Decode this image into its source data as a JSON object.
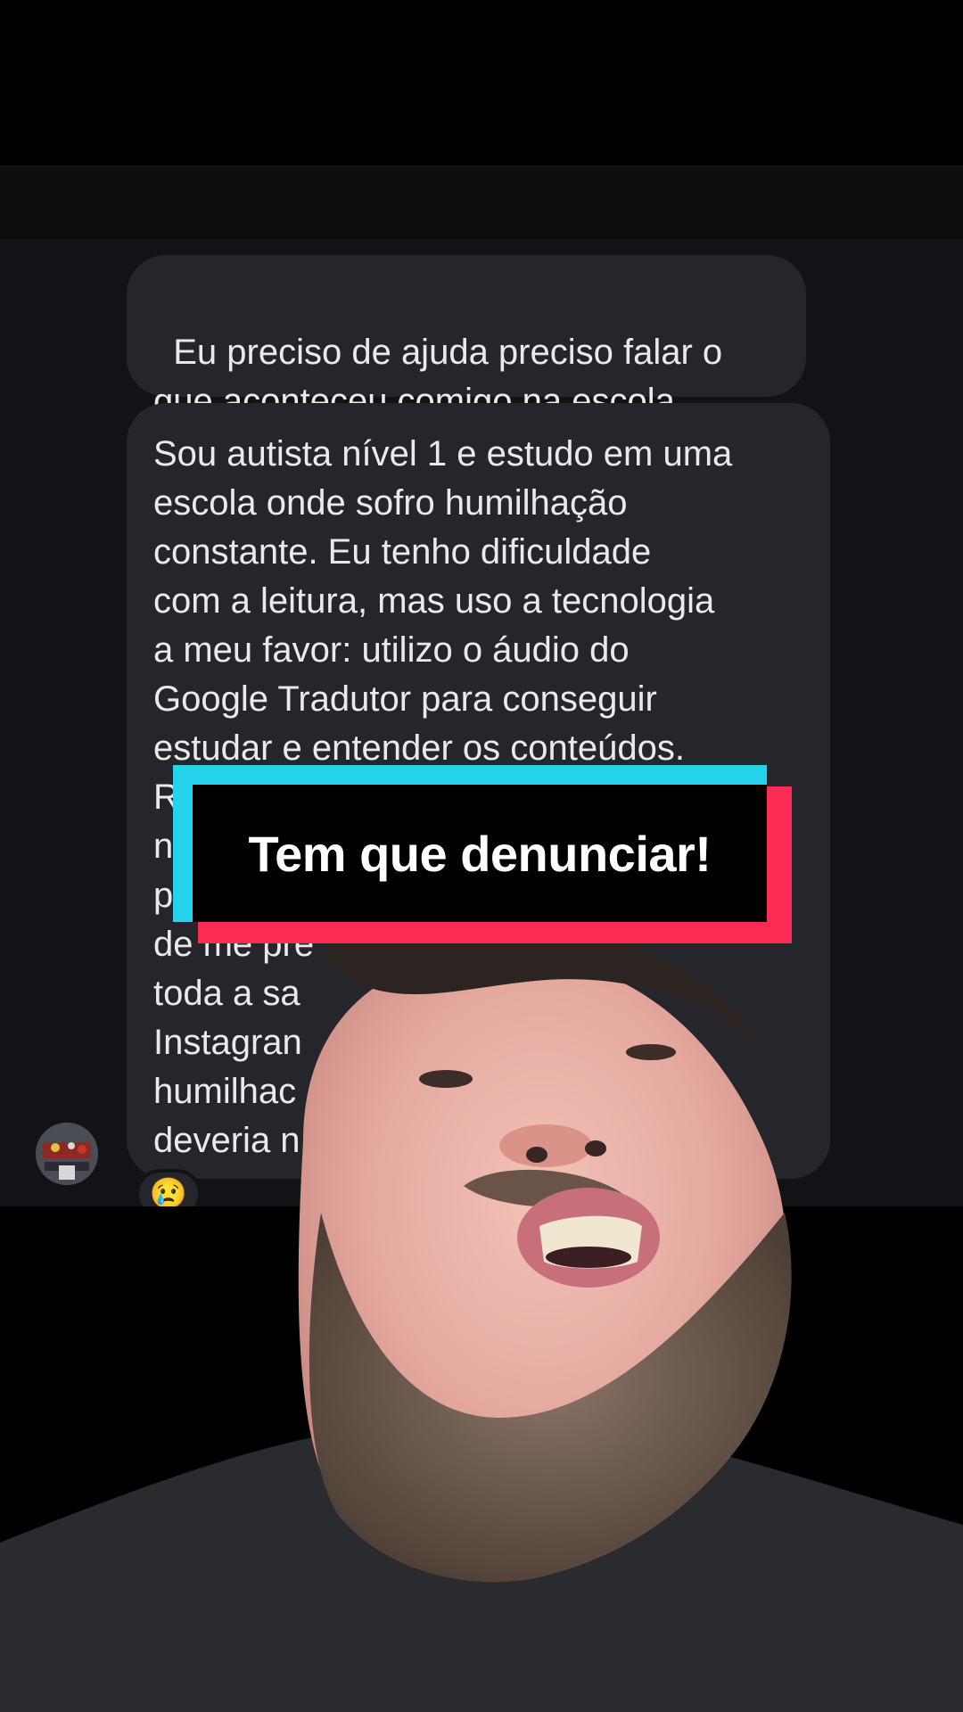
{
  "chat": {
    "message_1": "Eu preciso de ajuda preciso falar o\nque aconteceu comigo na escola",
    "message_2_lines": [
      "Sou autista nível 1 e estudo em uma",
      "escola onde sofro humilhação",
      "constante. Eu tenho dificuldade",
      "com a leitura, mas uso a tecnologia",
      "a meu favor: utilizo o áudio do",
      "Google Tradutor para conseguir",
      "estudar e entender os conteúdos.",
      "R",
      "n",
      "p",
      "de me pre",
      "toda a sa",
      "Instagran",
      "humilhac",
      "deveria n"
    ],
    "reaction": "😢",
    "avatar_icon": "user-avatar"
  },
  "caption": {
    "text": "Tem que denunciar!",
    "colors": {
      "cyan": "#25d3ec",
      "red": "#fe2c55",
      "box": "#000000"
    }
  }
}
